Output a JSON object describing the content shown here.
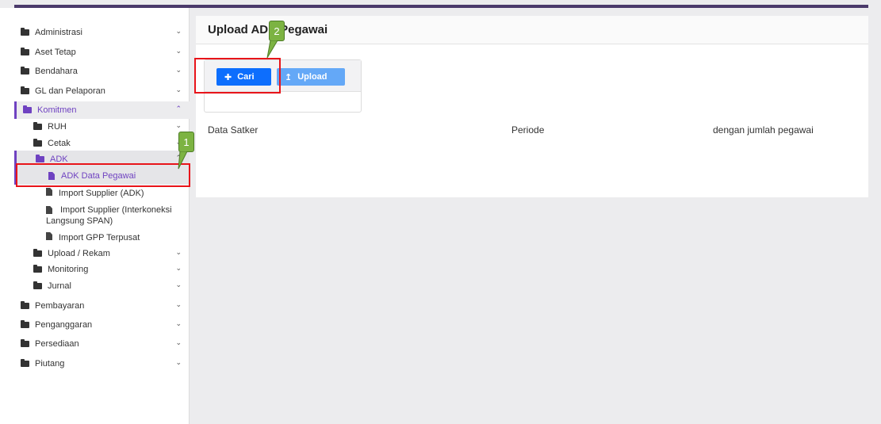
{
  "sidebar": {
    "items": [
      {
        "label": "Administrasi"
      },
      {
        "label": "Aset Tetap"
      },
      {
        "label": "Bendahara"
      },
      {
        "label": "GL dan Pelaporan"
      },
      {
        "label": "Komitmen"
      },
      {
        "label": "RUH"
      },
      {
        "label": "Cetak"
      },
      {
        "label": "ADK"
      },
      {
        "label": "Upload / Rekam"
      },
      {
        "label": "Monitoring"
      },
      {
        "label": "Jurnal"
      },
      {
        "label": "Pembayaran"
      },
      {
        "label": "Penganggaran"
      },
      {
        "label": "Persediaan"
      },
      {
        "label": "Piutang"
      }
    ],
    "files": [
      {
        "label": "ADK Data Pegawai"
      },
      {
        "label": "Import Supplier (ADK)"
      },
      {
        "label": "Import Supplier (Interkoneksi Langsung SPAN)"
      },
      {
        "label": "Import GPP Terpusat"
      }
    ]
  },
  "main": {
    "title": "Upload ADK Pegawai",
    "buttons": {
      "cari": "Cari",
      "upload": "Upload"
    },
    "info": {
      "satker": "Data Satker",
      "periode": "Periode",
      "jumlah": "dengan jumlah pegawai"
    }
  },
  "annotations": {
    "first": "1",
    "second": "2"
  },
  "colors": {
    "accent": "#6f42c1",
    "primary": "#0d6efd",
    "highlight": "#e8141a",
    "callout": "#7cb342"
  }
}
